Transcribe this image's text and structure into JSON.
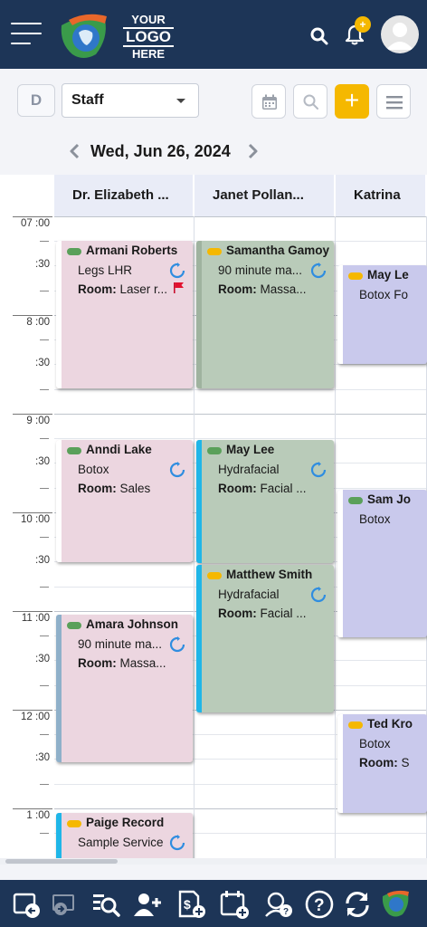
{
  "header": {
    "logo_line1": "YOUR",
    "logo_line2": "LOGO",
    "logo_line3": "HERE",
    "notification_badge": "+"
  },
  "toolbar": {
    "view_button": "D",
    "resource_select": "Staff",
    "add_label": "+"
  },
  "date_nav": {
    "date": "Wed, Jun 26, 2024"
  },
  "columns": [
    {
      "name": "Dr. Elizabeth ..."
    },
    {
      "name": "Janet Pollan..."
    },
    {
      "name": "Katrina"
    }
  ],
  "time_labels": [
    {
      "label": "07 :00"
    },
    {
      "label": ":30"
    },
    {
      "label": "8 :00"
    },
    {
      "label": ":30"
    },
    {
      "label": "9 :00"
    },
    {
      "label": ":30"
    },
    {
      "label": "10 :00"
    },
    {
      "label": ":30"
    },
    {
      "label": "11 :00"
    },
    {
      "label": ":30"
    },
    {
      "label": "12 :00"
    },
    {
      "label": ":30"
    },
    {
      "label": "1 :00"
    }
  ],
  "appointments": [
    {
      "name": "Armani Roberts",
      "service": "Legs LHR",
      "room_label": "Room:",
      "room": "Laser r...",
      "sync": true,
      "flag": true
    },
    {
      "name": "Samantha Gamoy",
      "service": "90 minute ma...",
      "room_label": "Room:",
      "room": "Massa...",
      "sync": true
    },
    {
      "name": "May Le",
      "service": "Botox Fo"
    },
    {
      "name": "Anndi Lake",
      "service": "Botox",
      "room_label": "Room:",
      "room": "Sales",
      "sync": true
    },
    {
      "name": "May Lee",
      "service": "Hydrafacial",
      "room_label": "Room:",
      "room": "Facial ...",
      "sync": true
    },
    {
      "name": "Sam Jo",
      "service": "Botox"
    },
    {
      "name": "Matthew Smith",
      "service": "Hydrafacial",
      "room_label": "Room:",
      "room": "Facial ...",
      "sync": true
    },
    {
      "name": "Amara Johnson",
      "service": "90 minute ma...",
      "room_label": "Room:",
      "room": "Massa...",
      "sync": true
    },
    {
      "name": "Ted Kro",
      "service": "Botox",
      "room_label": "Room:",
      "room": "S"
    },
    {
      "name": "Paige Record",
      "service": "Sample Service",
      "sync": true
    }
  ],
  "colors": {
    "header_bg": "#1d3557",
    "accent_yellow": "#f5b800",
    "status_green": "#5aa05a",
    "status_yellow": "#f5b800",
    "stripe_blue": "#1fb6e8",
    "appt_pink": "#ecd6e0",
    "appt_green": "#b9cbb9",
    "appt_lavender": "#c9c9ec"
  },
  "bottom_nav_icons": [
    "exit-to-screen-icon",
    "switch-screen-icon",
    "search-list-icon",
    "add-user-icon",
    "add-invoice-icon",
    "add-calendar-icon",
    "support-agent-icon",
    "help-icon",
    "refresh-icon",
    "logo-globe-icon"
  ]
}
